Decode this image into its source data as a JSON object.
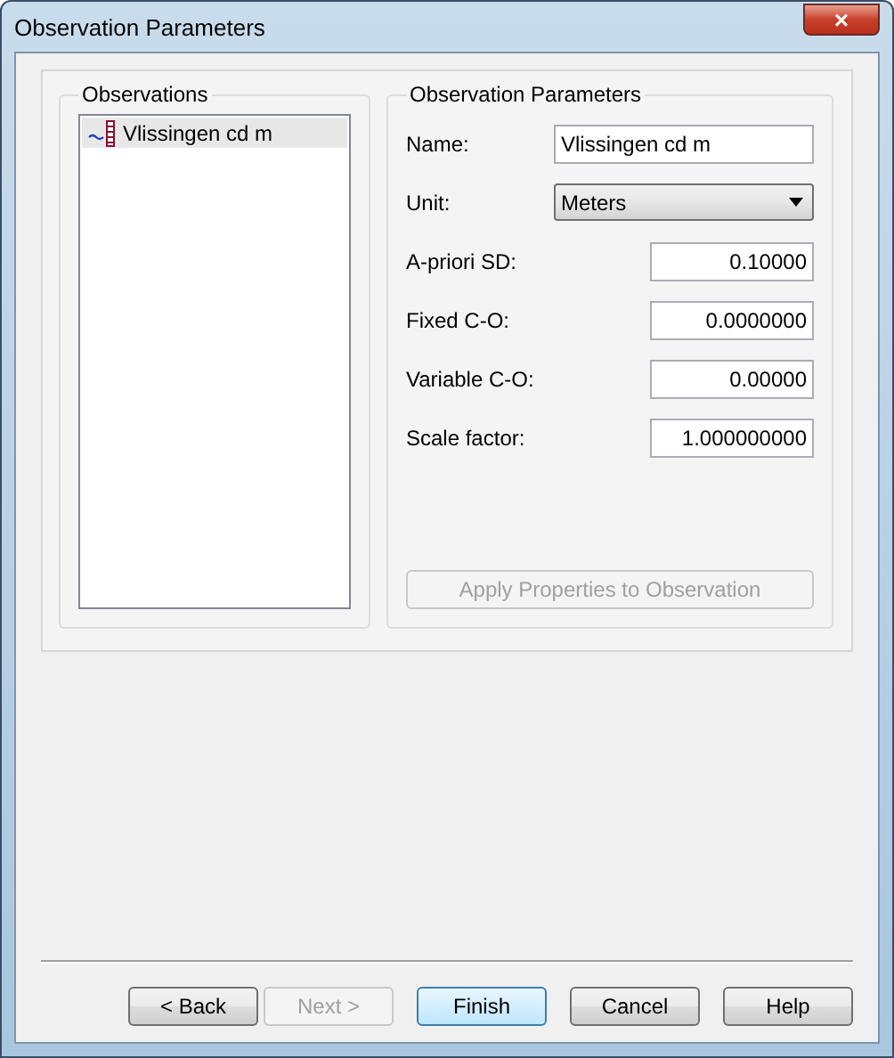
{
  "window": {
    "title": "Observation Parameters",
    "close": "×"
  },
  "observations": {
    "title": "Observations",
    "items": [
      {
        "label": "Vlissingen cd m",
        "selected": true
      }
    ]
  },
  "parameters": {
    "title": "Observation Parameters",
    "fields": [
      {
        "kind": "text",
        "label": "Name:",
        "value": "Vlissingen cd m"
      },
      {
        "kind": "select",
        "label": "Unit:",
        "value": "Meters"
      },
      {
        "kind": "number",
        "label": "A-priori SD:",
        "value": "0.10000"
      },
      {
        "kind": "number",
        "label": "Fixed C-O:",
        "value": "0.0000000"
      },
      {
        "kind": "number",
        "label": "Variable C-O:",
        "value": "0.00000"
      },
      {
        "kind": "number",
        "label": "Scale factor:",
        "value": "1.000000000"
      }
    ],
    "apply": {
      "label": "Apply Properties to Observation",
      "disabled": true
    }
  },
  "buttons": [
    {
      "label": "< Back",
      "disabled": false,
      "default": false
    },
    {
      "label": "Next >",
      "disabled": true,
      "default": false
    },
    {
      "label": "Finish",
      "disabled": false,
      "default": true
    },
    {
      "label": "Cancel",
      "disabled": false,
      "default": false
    },
    {
      "label": "Help",
      "disabled": false,
      "default": false
    }
  ]
}
